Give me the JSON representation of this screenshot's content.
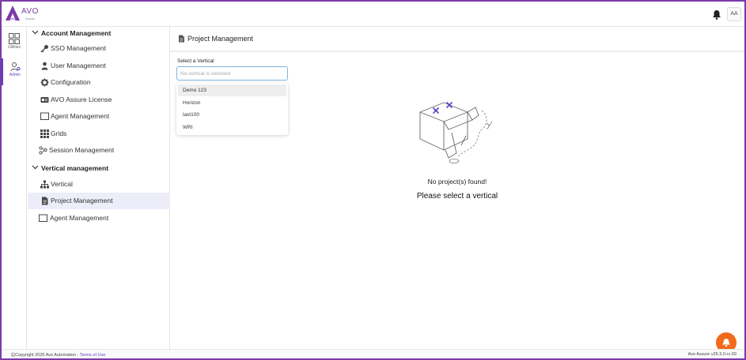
{
  "header": {
    "brand": "AVO",
    "brand_tagline": "Assure",
    "user_initials": "AA"
  },
  "rail": {
    "items": [
      {
        "label": "Utilities",
        "icon": "grid-icon",
        "active": false
      },
      {
        "label": "Admin",
        "icon": "admin-user-icon",
        "active": true
      }
    ]
  },
  "sidebar": {
    "sections": [
      {
        "title": "Account Management",
        "items": [
          {
            "label": "SSO Management",
            "icon": "key-icon"
          },
          {
            "label": "User Management",
            "icon": "user-icon"
          },
          {
            "label": "Configuration",
            "icon": "gear-icon"
          },
          {
            "label": "AVO Assure License",
            "icon": "license-card-icon"
          },
          {
            "label": "Agent Management",
            "icon": "monitor-icon"
          },
          {
            "label": "Grids",
            "icon": "grid-dots-icon"
          },
          {
            "label": "Session Management",
            "icon": "session-nodes-icon"
          }
        ]
      },
      {
        "title": "Vertical management",
        "items": [
          {
            "label": "Vertical",
            "icon": "hierarchy-icon"
          },
          {
            "label": "Project Management",
            "icon": "document-icon",
            "active": true
          },
          {
            "label": "Agent Management",
            "icon": "monitor-icon"
          }
        ]
      }
    ]
  },
  "main": {
    "title": "Project Management",
    "field_label": "Select a Vertical",
    "select_placeholder": "No vertical is selected",
    "options": [
      "Demo 123",
      "Horizon",
      "last100",
      "WRI"
    ],
    "empty_title": "No project(s) found!",
    "empty_subtitle": "Please select a vertical"
  },
  "footer": {
    "copyright_symbol": "©",
    "copyright": "Copyright 2025 Avo Automation",
    "separator": " - ",
    "terms": "Terms of Use",
    "version": "Avo Assure v25.3.0-rc.69"
  },
  "colors": {
    "accent": "#5b3fc4",
    "frame": "#7a3aa8",
    "fab": "#f26a1b",
    "active_bg": "#ecedf9"
  }
}
